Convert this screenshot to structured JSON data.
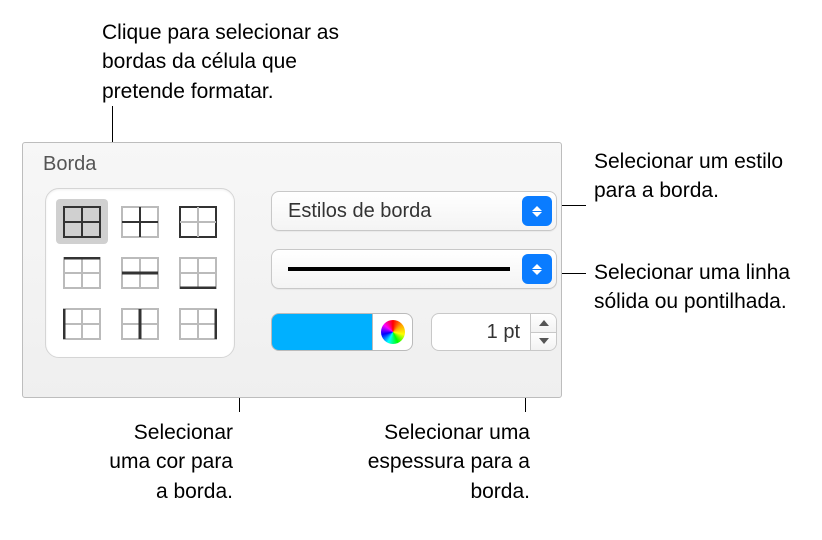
{
  "annotations": {
    "top": "Clique para selecionar as bordas da célula que pretende formatar.",
    "right1": "Selecionar um estilo para a borda.",
    "right2": "Selecionar uma linha sólida ou pontilhada.",
    "bottom1": "Selecionar uma cor para a borda.",
    "bottom2": "Selecionar uma espessura para a borda."
  },
  "panel": {
    "title": "Borda",
    "style_dropdown_label": "Estilos de borda",
    "thickness_value": "1 pt",
    "line_style": "solid",
    "color": "#00b0ff"
  },
  "border_options": [
    {
      "name": "all-borders",
      "selected": true
    },
    {
      "name": "outer-borders",
      "selected": false
    },
    {
      "name": "inner-borders",
      "selected": false
    },
    {
      "name": "top-border",
      "selected": false
    },
    {
      "name": "horizontal-inner-border",
      "selected": false
    },
    {
      "name": "bottom-border",
      "selected": false
    },
    {
      "name": "left-border",
      "selected": false
    },
    {
      "name": "vertical-inner-border",
      "selected": false
    },
    {
      "name": "right-border",
      "selected": false
    }
  ]
}
